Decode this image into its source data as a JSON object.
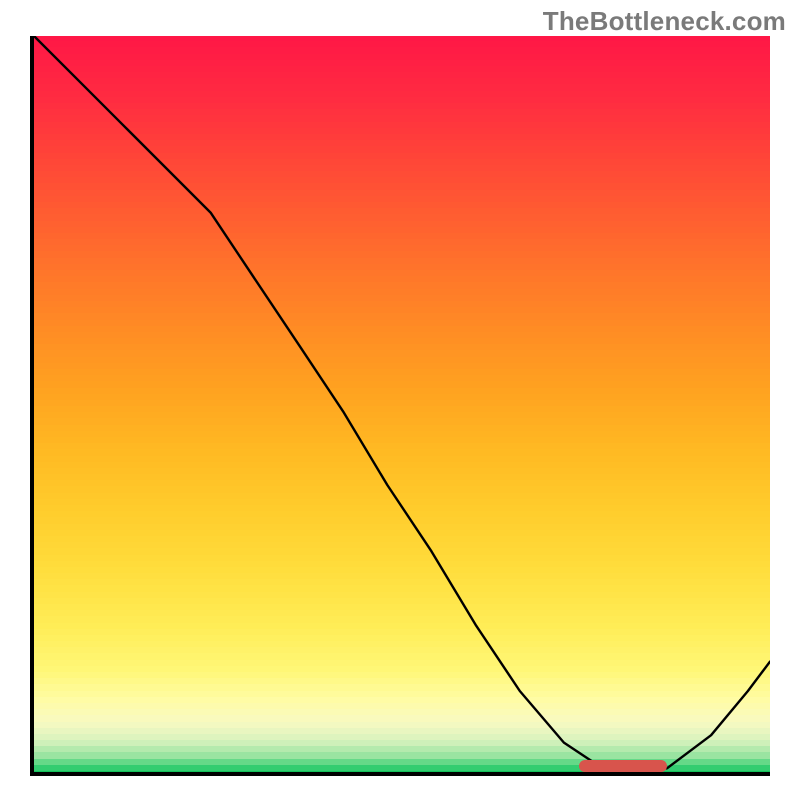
{
  "watermark": "TheBottleneck.com",
  "colors": {
    "axis": "#000000",
    "curve": "#000000",
    "marker": "#d8544c"
  },
  "chart_data": {
    "type": "line",
    "title": "",
    "xlabel": "",
    "ylabel": "",
    "xlim": [
      0,
      100
    ],
    "ylim": [
      0,
      100
    ],
    "grid": false,
    "legend": false,
    "series": [
      {
        "name": "bottleneck-curve",
        "x": [
          0,
          6,
          12,
          18,
          24,
          30,
          36,
          42,
          48,
          54,
          60,
          66,
          72,
          78,
          81,
          86,
          92,
          97,
          100
        ],
        "y": [
          100,
          94,
          88,
          82,
          76,
          67,
          58,
          49,
          39,
          30,
          20,
          11,
          4,
          0,
          0,
          0.5,
          5,
          11,
          15
        ]
      }
    ],
    "annotations": [
      {
        "name": "marker",
        "x_start": 74,
        "x_end": 86,
        "y": 0.8
      }
    ],
    "gradient": {
      "stops": [
        {
          "pos": 0.0,
          "color": "#ff1846"
        },
        {
          "pos": 0.08,
          "color": "#ff2b41"
        },
        {
          "pos": 0.16,
          "color": "#ff4438"
        },
        {
          "pos": 0.24,
          "color": "#ff5d31"
        },
        {
          "pos": 0.32,
          "color": "#ff762a"
        },
        {
          "pos": 0.4,
          "color": "#ff8d24"
        },
        {
          "pos": 0.48,
          "color": "#ffa320"
        },
        {
          "pos": 0.56,
          "color": "#ffb923"
        },
        {
          "pos": 0.64,
          "color": "#ffcc2c"
        },
        {
          "pos": 0.72,
          "color": "#ffdd3c"
        },
        {
          "pos": 0.8,
          "color": "#ffed57"
        },
        {
          "pos": 0.86,
          "color": "#fff778"
        },
        {
          "pos": 0.9,
          "color": "#fffca6"
        },
        {
          "pos": 0.93,
          "color": "#f7fac2"
        },
        {
          "pos": 0.955,
          "color": "#d7f2bd"
        },
        {
          "pos": 0.975,
          "color": "#99e4a1"
        },
        {
          "pos": 0.99,
          "color": "#39cf74"
        },
        {
          "pos": 1.0,
          "color": "#13c05a"
        }
      ]
    }
  }
}
